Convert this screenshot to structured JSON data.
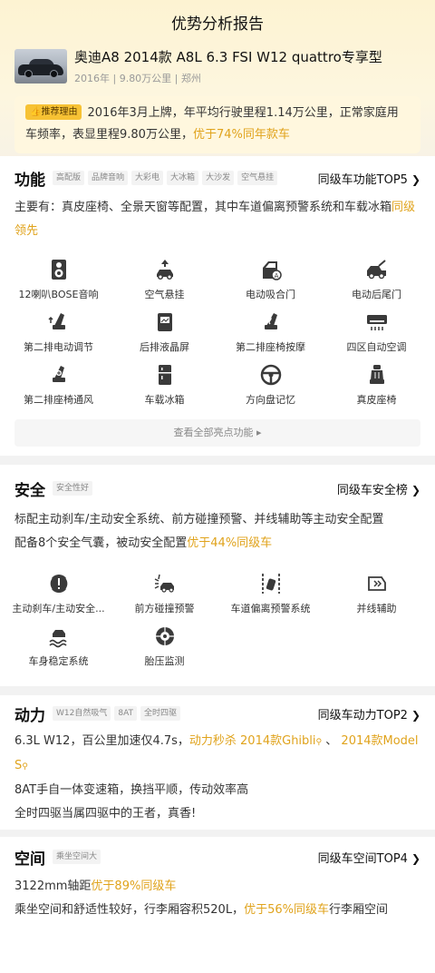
{
  "header": {
    "title": "优势分析报告"
  },
  "car": {
    "name": "奥迪A8 2014款 A8L 6.3 FSI W12 quattro专享型",
    "meta": "2016年 | 9.80万公里 | 郑州"
  },
  "recommend": {
    "badge": "推荐理由",
    "text": "2016年3月上牌，年平均行驶里程1.14万公里，正常家庭用车频率，表显里程9.80万公里，",
    "highlight": "优于74%同年款车"
  },
  "features": {
    "title": "功能",
    "tags": [
      "高配版",
      "品牌音响",
      "大彩电",
      "大冰箱",
      "大沙发",
      "空气悬挂"
    ],
    "link": "同级车功能TOP5",
    "desc": "主要有：真皮座椅、全景天窗等配置，其中车道偏离预警系统和车载冰箱",
    "desc_highlight": "同级领先",
    "items": [
      {
        "label": "12喇叭BOSE音响",
        "icon": "speaker-icon"
      },
      {
        "label": "空气悬挂",
        "icon": "air-suspension-icon"
      },
      {
        "label": "电动吸合门",
        "icon": "soft-close-door-icon"
      },
      {
        "label": "电动后尾门",
        "icon": "power-tailgate-icon"
      },
      {
        "label": "第二排电动调节",
        "icon": "seat-adjust-icon"
      },
      {
        "label": "后排液晶屏",
        "icon": "rear-screen-icon"
      },
      {
        "label": "第二排座椅按摩",
        "icon": "seat-massage-icon"
      },
      {
        "label": "四区自动空调",
        "icon": "climate-icon"
      },
      {
        "label": "第二排座椅通风",
        "icon": "seat-ventilation-icon"
      },
      {
        "label": "车载冰箱",
        "icon": "fridge-icon"
      },
      {
        "label": "方向盘记忆",
        "icon": "steering-wheel-icon"
      },
      {
        "label": "真皮座椅",
        "icon": "leather-seat-icon"
      }
    ],
    "more": "查看全部亮点功能"
  },
  "safety": {
    "title": "安全",
    "tags": [
      "安全性好"
    ],
    "link": "同级车安全榜",
    "desc1": "标配主动刹车/主动安全系统、前方碰撞预警、并线辅助等主动安全配置",
    "desc2": "配备8个安全气囊，被动安全配置",
    "desc2_highlight": "优于44%同级车",
    "items": [
      {
        "label": "主动刹车/主动安全...",
        "icon": "brake-warning-icon"
      },
      {
        "label": "前方碰撞预警",
        "icon": "collision-warning-icon"
      },
      {
        "label": "车道偏离预警系统",
        "icon": "lane-departure-icon"
      },
      {
        "label": "并线辅助",
        "icon": "blind-spot-icon"
      },
      {
        "label": "车身稳定系统",
        "icon": "stability-icon"
      },
      {
        "label": "胎压监测",
        "icon": "tire-pressure-icon"
      }
    ]
  },
  "power": {
    "title": "动力",
    "tags": [
      "W12自然吸气",
      "8AT",
      "全时四驱"
    ],
    "link": "同级车动力TOP2",
    "line1": "6.3L W12，百公里加速仅4.7s，",
    "line1_hl1": "动力秒杀 2014款Ghibli",
    "line1_sep": "、",
    "line1_hl2": "2014款Model S",
    "line2": "8AT手自一体变速箱，换挡平顺，传动效率高",
    "line3": "全时四驱当属四驱中的王者，真香!"
  },
  "space": {
    "title": "空间",
    "tags": [
      "乘坐空间大"
    ],
    "link": "同级车空间TOP4",
    "line1": "3122mm轴距",
    "line1_hl": "优于89%同级车",
    "line2": "乘坐空间和舒适性较好，行李厢容积520L，",
    "line2_hl": "优于56%同级车",
    "line2_tail": "行李厢空间"
  },
  "colors": {
    "accent": "#e0a31c",
    "badge": "#f7c234"
  }
}
